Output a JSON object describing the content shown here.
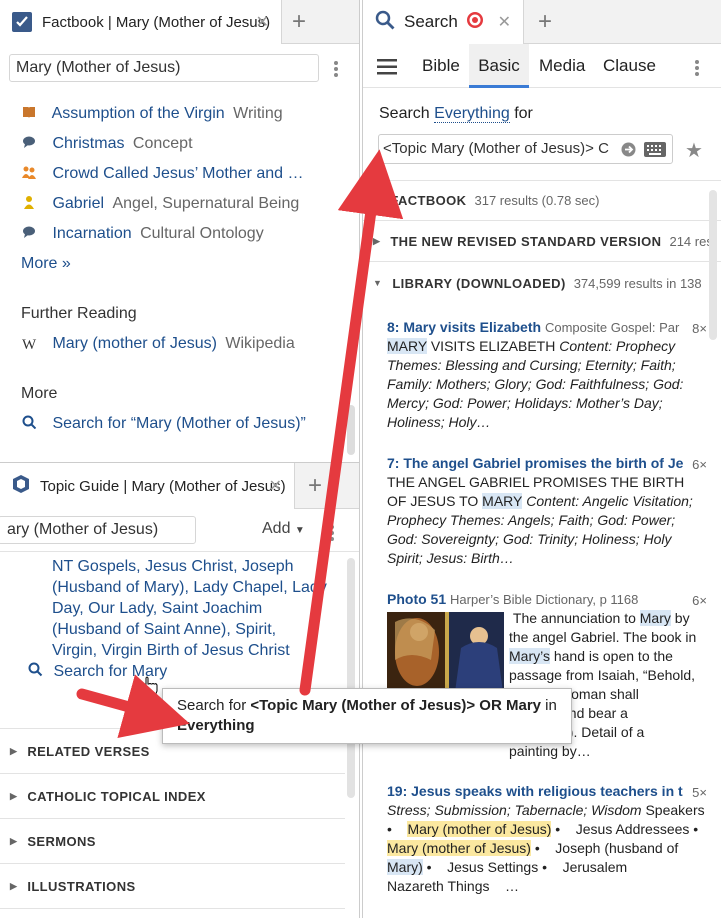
{
  "factbook": {
    "tab_title": "Factbook | Mary (Mother of Jesus)",
    "search_value": "Mary (Mother of Jesus)",
    "items": [
      {
        "name": "Assumption of the Virgin",
        "type": "Writing",
        "icon": "book-icon",
        "color": "#c9762c"
      },
      {
        "name": "Christmas",
        "type": "Concept",
        "icon": "speech-bubble-icon",
        "color": "#4a5f78"
      },
      {
        "name": "Crowd Called Jesus’ Mother and …",
        "type": "",
        "icon": "people-icon",
        "color": "#e9892a"
      },
      {
        "name": "Gabriel",
        "type": "Angel, Supernatural Being",
        "icon": "person-icon",
        "color": "#e0b000"
      },
      {
        "name": "Incarnation",
        "type": "Cultural Ontology",
        "icon": "speech-bubble-icon",
        "color": "#4a5f78"
      }
    ],
    "more_link": "More »",
    "further_reading_heading": "Further Reading",
    "wiki_link": "Mary (mother of Jesus)",
    "wiki_source": "Wikipedia",
    "more_heading": "More",
    "search_for_link": "Search for “Mary (Mother of Jesus)”"
  },
  "topic_guide": {
    "tab_title": "Topic Guide | Mary (Mother of Jesus)",
    "search_value": "ary (Mother of Jesus)",
    "add_label": "Add",
    "links_lines": [
      "NT Gospels, Jesus Christ, Joseph",
      "(Husband of Mary), Lady Chapel, Lady",
      "Day, Our Lady, Saint Joachim",
      "(Husband of Saint Anne), Spirit,",
      "Virgin, Virgin Birth of Jesus Christ"
    ],
    "search_for_mary": "Search for Mary",
    "sections": [
      "RELATED VERSES",
      "CATHOLIC TOPICAL INDEX",
      "SERMONS",
      "ILLUSTRATIONS"
    ]
  },
  "tooltip": {
    "prefix": "Search for",
    "query": "<Topic Mary (Mother of Jesus)> OR Mary",
    "mid": "in",
    "target": "Everything"
  },
  "search": {
    "tab_title": "Search",
    "tabs": [
      "Bible",
      "Basic",
      "Media",
      "Clause"
    ],
    "active_tab": "Basic",
    "search_label_prefix": "Search",
    "search_scope": "Everything",
    "search_label_suffix": "for",
    "query_value": "<Topic Mary (Mother of Jesus)> C",
    "groups": [
      {
        "name": "FACTBOOK",
        "count": "317 results (0.78 sec)"
      },
      {
        "name": "THE NEW REVISED STANDARD VERSION",
        "count": "214 res"
      },
      {
        "name": "LIBRARY (DOWNLOADED)",
        "count": "374,599 results in 138"
      }
    ],
    "results": [
      {
        "title": "8: Mary visits Elizabeth",
        "source": "Composite Gospel: Par",
        "badge": "8×",
        "hl_word": "MARY",
        "body_caps": " VISITS ELIZABETH ",
        "body_rest": "Content: Prophecy Themes: Blessing and Cursing; Eternity; Faith; Family: Mothers; Glory; God: Faithfulness; God: Mercy; God: Power; Holidays: Mother’s Day; Holiness; Holy…"
      },
      {
        "title": "7: The angel Gabriel promises the birth of Je",
        "badge": "6×",
        "body_caps": "THE ANGEL GABRIEL PROMISES THE BIRTH OF JESUS TO ",
        "hl_word": "MARY",
        "body_rest": " Content: Angelic Visitation; Prophecy Themes: Angels; Faith; God: Power; God: Sovereignty; God: Trinity; Holiness; Holy Spirit; Jesus: Birth…"
      },
      {
        "title": "Photo 51",
        "source": "Harper’s Bible Dictionary, p 1168",
        "badge": "6×",
        "lines": [
          "The annunciation to",
          "Mary",
          "by",
          "the angel Gabriel. The book in",
          "Mary’s",
          "hand is open to the",
          "passage from Isaiah, “Behold,",
          "woman shall",
          "and bear a",
          "4). Detail of a",
          "painting by…"
        ]
      },
      {
        "title": "19: Jesus speaks with religious teachers in t",
        "badge": "5×",
        "line1": "Stress; Submission; Tabernacle; Wisdom",
        "line1b": "Speakers",
        "line2a": "Mary (mother of Jesus)",
        "line2b": "Jesus",
        "line2c": "Addressees",
        "line3a": "Mary (mother of Jesus)",
        "line3b": "Joseph (husband of",
        "line4a": "Mary)",
        "line4b": "Jesus",
        "line4c": "Settings",
        "line4d": "Jerusalem",
        "line5": "Nazareth",
        "line5b": "Things",
        "line5c": "…"
      }
    ]
  },
  "colors": {
    "accent_red": "#e53a3f",
    "link": "#1e4f8c",
    "highlight_blue": "#d8e6f4",
    "highlight_yellow": "#fbe8a0"
  }
}
